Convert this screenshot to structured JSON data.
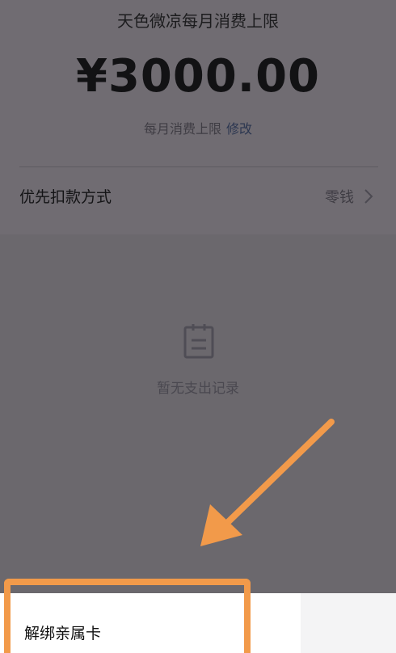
{
  "header": {
    "title": "天色微凉每月消费上限",
    "amount": "¥3000.00",
    "limit_label": "每月消费上限",
    "limit_edit": "修改"
  },
  "payment": {
    "label": "优先扣款方式",
    "value": "零钱"
  },
  "empty_state": {
    "icon": "notepad-icon",
    "text": "暂无支出记录"
  },
  "sheet": {
    "unbind_label": "解绑亲属卡"
  },
  "colors": {
    "overlay": "#6b686d",
    "highlight": "#f29a4a",
    "sheet": "#ffffff"
  }
}
